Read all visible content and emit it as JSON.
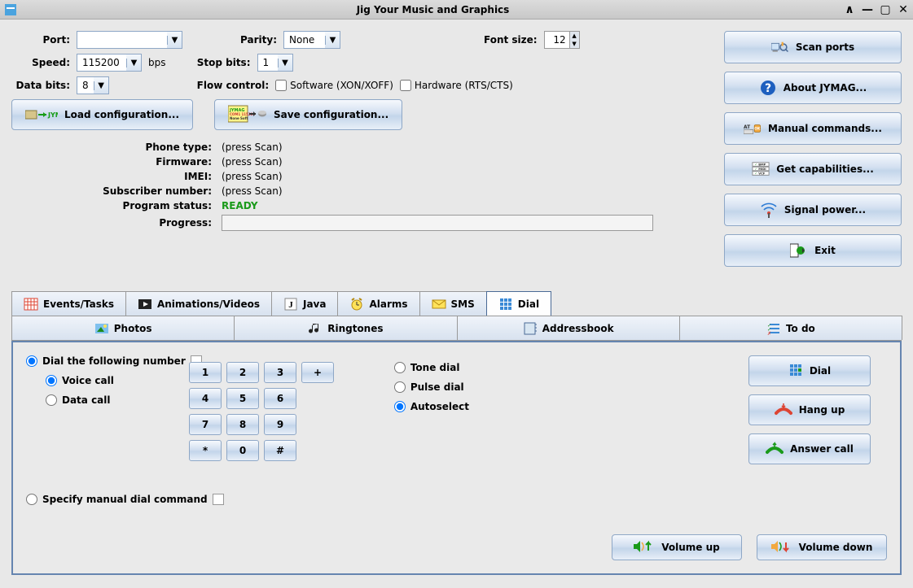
{
  "window": {
    "title": "Jig Your Music and Graphics"
  },
  "settings": {
    "port_label": "Port:",
    "port_value": "",
    "speed_label": "Speed:",
    "speed_value": "115200",
    "speed_unit": "bps",
    "databits_label": "Data bits:",
    "databits_value": "8",
    "parity_label": "Parity:",
    "parity_value": "None",
    "stopbits_label": "Stop bits:",
    "stopbits_value": "1",
    "flow_label": "Flow control:",
    "flow_software": "Software (XON/XOFF)",
    "flow_hardware": "Hardware (RTS/CTS)",
    "fontsize_label": "Font size:",
    "fontsize_value": "12"
  },
  "config": {
    "load": "Load configuration...",
    "save": "Save configuration..."
  },
  "info": {
    "phone_type_label": "Phone type:",
    "phone_type_value": "(press Scan)",
    "firmware_label": "Firmware:",
    "firmware_value": "(press Scan)",
    "imei_label": "IMEI:",
    "imei_value": "(press Scan)",
    "subscriber_label": "Subscriber number:",
    "subscriber_value": "(press Scan)",
    "status_label": "Program status:",
    "status_value": "READY",
    "progress_label": "Progress:"
  },
  "sidebar": {
    "scan": "Scan ports",
    "about": "About JYMAG...",
    "manual": "Manual commands...",
    "capabilities": "Get capabilities...",
    "signal": "Signal power...",
    "exit": "Exit"
  },
  "tabs": {
    "events": "Events/Tasks",
    "animations": "Animations/Videos",
    "java": "Java",
    "alarms": "Alarms",
    "sms": "SMS",
    "dial": "Dial",
    "photos": "Photos",
    "ringtones": "Ringtones",
    "addressbook": "Addressbook",
    "todo": "To do"
  },
  "dial": {
    "dial_number_option": "Dial the following number",
    "voice_call": "Voice call",
    "data_call": "Data call",
    "tone_dial": "Tone dial",
    "pulse_dial": "Pulse dial",
    "autoselect": "Autoselect",
    "manual_option": "Specify manual dial command",
    "keys": [
      "1",
      "2",
      "3",
      "+",
      "4",
      "5",
      "6",
      "7",
      "8",
      "9",
      "*",
      "0",
      "#"
    ],
    "dial_btn": "Dial",
    "hangup_btn": "Hang up",
    "answer_btn": "Answer call",
    "volup_btn": "Volume up",
    "voldown_btn": "Volume down"
  }
}
